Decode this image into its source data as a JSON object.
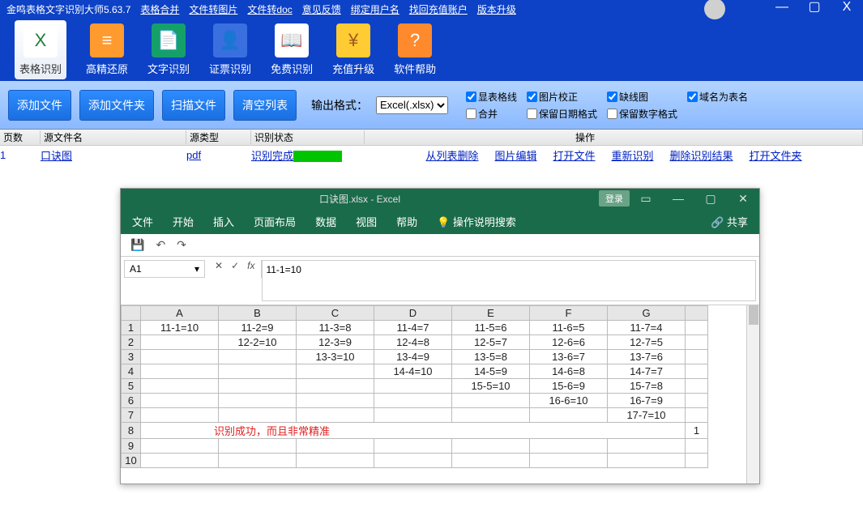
{
  "app": {
    "title": "金鸣表格文字识别大师5.63.7",
    "topLinks": [
      "表格合并",
      "文件转图片",
      "文件转doc",
      "意见反馈",
      "绑定用户名",
      "找回充值账户",
      "版本升级"
    ],
    "winMin": "—",
    "winMax": "▢",
    "winClose": "X"
  },
  "tools": [
    {
      "label": "表格识别",
      "icon_bg": "#fff",
      "glyph": "X",
      "glyph_color": "#1e7e34",
      "active": true
    },
    {
      "label": "高精还原",
      "icon_bg": "#ff9a2e",
      "glyph": "≡",
      "glyph_color": "#fff"
    },
    {
      "label": "文字识别",
      "icon_bg": "#15a06a",
      "glyph": "📄",
      "glyph_color": "#fff"
    },
    {
      "label": "证票识别",
      "icon_bg": "#3a6fe0",
      "glyph": "👤",
      "glyph_color": "#fff"
    },
    {
      "label": "免费识别",
      "icon_bg": "#ffffff",
      "glyph": "📖",
      "glyph_color": "#a05a1e"
    },
    {
      "label": "充值升级",
      "icon_bg": "#ffcc33",
      "glyph": "¥",
      "glyph_color": "#a05a1e"
    },
    {
      "label": "软件帮助",
      "icon_bg": "#ff8a2e",
      "glyph": "?",
      "glyph_color": "#fff"
    }
  ],
  "buttons": {
    "add_file": "添加文件",
    "add_folder": "添加文件夹",
    "scan": "扫描文件",
    "clear": "清空列表"
  },
  "output": {
    "label": "输出格式：",
    "value": "Excel(.xlsx)"
  },
  "checks": [
    {
      "label": "显表格线",
      "v": true
    },
    {
      "label": "图片校正",
      "v": true
    },
    {
      "label": "缺线图",
      "v": true
    },
    {
      "label": "域名为表名",
      "v": true
    },
    {
      "label": "合并",
      "v": false
    },
    {
      "label": "保留日期格式",
      "v": false
    },
    {
      "label": "保留数字格式",
      "v": false
    }
  ],
  "grid": {
    "cols": [
      "页数",
      "源文件名",
      "源类型",
      "识别状态",
      "操作"
    ],
    "row": {
      "page": "1",
      "file": "口诀图",
      "type": "pdf",
      "status": "识别完成",
      "ops": [
        "从列表删除",
        "图片编辑",
        "打开文件",
        "重新识别",
        "删除识别结果",
        "打开文件夹"
      ]
    }
  },
  "excel": {
    "title": "口诀图.xlsx - Excel",
    "login": "登录",
    "tabs": [
      "文件",
      "开始",
      "插入",
      "页面布局",
      "数据",
      "视图",
      "帮助"
    ],
    "tell_icon": "💡",
    "tell": "操作说明搜索",
    "share": "共享",
    "share_icon": "🔗",
    "qat": {
      "save": "💾",
      "undo": "↶",
      "redo": "↷"
    },
    "namebox": "A1",
    "fx": "fx",
    "formula": "11-1=10",
    "cols": [
      "",
      "A",
      "B",
      "C",
      "D",
      "E",
      "F",
      "G",
      ""
    ],
    "rows": [
      [
        "1",
        "11-1=10",
        "11-2=9",
        "11-3=8",
        "11-4=7",
        "11-5=6",
        "11-6=5",
        "11-7=4",
        ""
      ],
      [
        "2",
        "",
        "12-2=10",
        "12-3=9",
        "12-4=8",
        "12-5=7",
        "12-6=6",
        "12-7=5",
        ""
      ],
      [
        "3",
        "",
        "",
        "13-3=10",
        "13-4=9",
        "13-5=8",
        "13-6=7",
        "13-7=6",
        ""
      ],
      [
        "4",
        "",
        "",
        "",
        "14-4=10",
        "14-5=9",
        "14-6=8",
        "14-7=7",
        ""
      ],
      [
        "5",
        "",
        "",
        "",
        "",
        "15-5=10",
        "15-6=9",
        "15-7=8",
        ""
      ],
      [
        "6",
        "",
        "",
        "",
        "",
        "",
        "16-6=10",
        "16-7=9",
        ""
      ],
      [
        "7",
        "",
        "",
        "",
        "",
        "",
        "",
        "17-7=10",
        ""
      ]
    ],
    "row8_num": "8",
    "row8_text": "识别成功，而且非常精准",
    "row8_last": "1",
    "row9": "9",
    "row10": "10"
  }
}
